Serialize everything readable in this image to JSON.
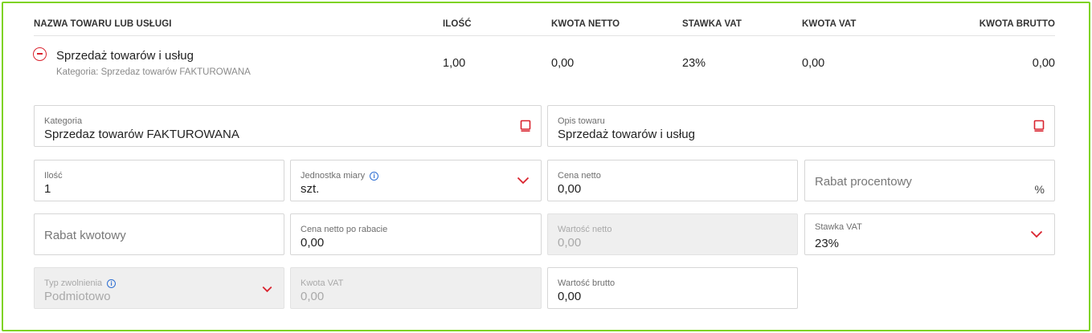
{
  "headers": {
    "name": "NAZWA TOWARU LUB USŁUGI",
    "qty": "ILOŚĆ",
    "net": "KWOTA NETTO",
    "vat_rate": "STAWKA VAT",
    "vat_amount": "KWOTA VAT",
    "gross": "KWOTA BRUTTO"
  },
  "item": {
    "name": "Sprzedaż towarów i usług",
    "category": "Kategoria: Sprzedaz towarów FAKTUROWANA",
    "qty": "1,00",
    "net": "0,00",
    "vat_rate": "23%",
    "vat_amount": "0,00",
    "gross": "0,00"
  },
  "form": {
    "kategoria": {
      "label": "Kategoria",
      "value": "Sprzedaz towarów FAKTUROWANA"
    },
    "opis": {
      "label": "Opis towaru",
      "value": "Sprzedaż towarów i usług"
    },
    "ilosc": {
      "label": "Ilość",
      "value": "1"
    },
    "jednostka": {
      "label": "Jednostka miary",
      "value": "szt."
    },
    "cena_netto": {
      "label": "Cena netto",
      "value": "0,00"
    },
    "rabat_procentowy": {
      "placeholder": "Rabat procentowy",
      "suffix": "%"
    },
    "rabat_kwotowy": {
      "placeholder": "Rabat kwotowy"
    },
    "cena_po_rabacie": {
      "label": "Cena netto po rabacie",
      "value": "0,00"
    },
    "wartosc_netto": {
      "label": "Wartość netto",
      "value": "0,00"
    },
    "stawka_vat": {
      "label": "Stawka VAT",
      "value": "23%"
    },
    "typ_zwolnienia": {
      "label": "Typ zwolnienia",
      "value": "Podmiotowo"
    },
    "kwota_vat": {
      "label": "Kwota VAT",
      "value": "0,00"
    },
    "wartosc_brutto": {
      "label": "Wartość brutto",
      "value": "0,00"
    }
  },
  "icons": {
    "collapse": "minus-circle-icon",
    "dictionary": "book-icon",
    "dropdown": "chevron-down-icon",
    "info": "info-icon"
  },
  "colors": {
    "accent": "#d9232e",
    "frame": "#7ed321",
    "info": "#2e6fd3"
  }
}
